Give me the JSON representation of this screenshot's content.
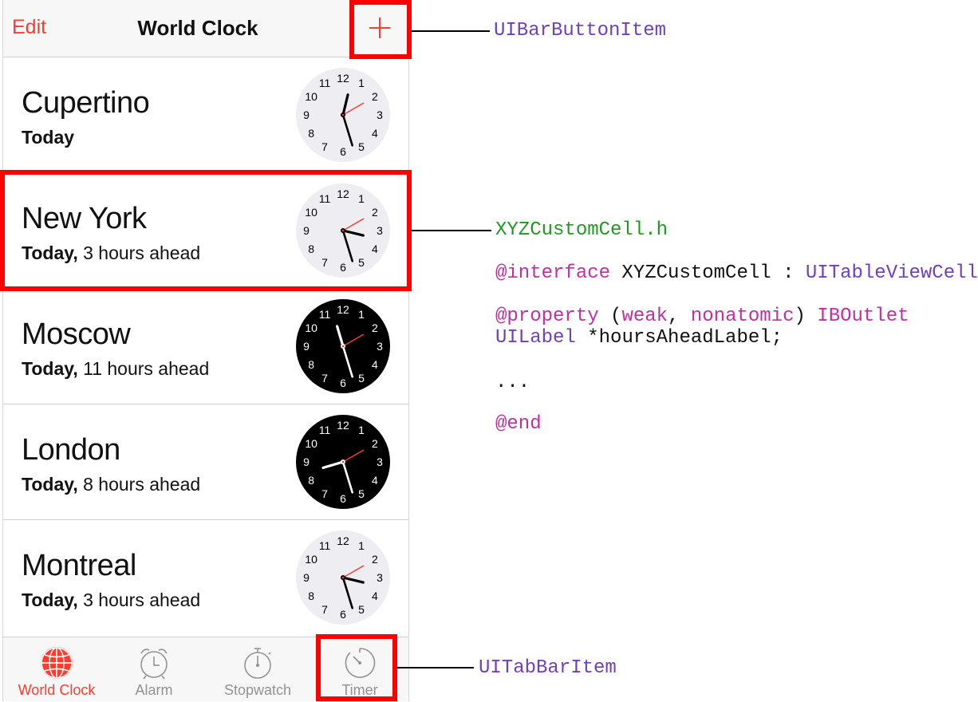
{
  "navbar": {
    "edit_label": "Edit",
    "title": "World Clock",
    "add_icon": "plus-icon"
  },
  "cities": [
    {
      "name": "Cupertino",
      "day": "Today",
      "offset": "",
      "theme": "light",
      "time": {
        "h": 12,
        "m": 27,
        "s": 10
      }
    },
    {
      "name": "New York",
      "day": "Today,",
      "offset": "3 hours ahead",
      "theme": "light",
      "time": {
        "h": 15,
        "m": 27,
        "s": 10
      }
    },
    {
      "name": "Moscow",
      "day": "Today,",
      "offset": "11 hours ahead",
      "theme": "dark",
      "time": {
        "h": 23,
        "m": 27,
        "s": 10
      }
    },
    {
      "name": "London",
      "day": "Today,",
      "offset": "8 hours ahead",
      "theme": "dark",
      "time": {
        "h": 20,
        "m": 27,
        "s": 10
      }
    },
    {
      "name": "Montreal",
      "day": "Today,",
      "offset": "3 hours ahead",
      "theme": "light",
      "time": {
        "h": 15,
        "m": 27,
        "s": 10
      }
    }
  ],
  "tabs": [
    {
      "label": "World Clock",
      "icon": "globe-icon",
      "active": true
    },
    {
      "label": "Alarm",
      "icon": "alarm-clock-icon",
      "active": false
    },
    {
      "label": "Stopwatch",
      "icon": "stopwatch-icon",
      "active": false
    },
    {
      "label": "Timer",
      "icon": "timer-icon",
      "active": false
    }
  ],
  "annotations": {
    "bar_button": "UIBarButtonItem",
    "header_file": "XYZCustomCell.h",
    "interface_kw": "@interface",
    "interface_name": " XYZCustomCell : ",
    "interface_super": "UITableViewCell",
    "property_kw": "@property",
    "property_open": " (",
    "property_weak": "weak",
    "property_comma": ", ",
    "property_nonatomic": "nonatomic",
    "property_close": ") ",
    "property_outlet": "IBOutlet",
    "label_type": "UILabel",
    "label_var": " *hoursAheadLabel;",
    "ellipsis": "...",
    "end_kw": "@end",
    "tab_item": "UITabBarItem"
  },
  "colors": {
    "accent": "#ff3b30",
    "highlight": "#ff0000",
    "code_type": "#6f3fbf",
    "code_keyword": "#c0309e",
    "code_file": "#1e9b1e"
  }
}
